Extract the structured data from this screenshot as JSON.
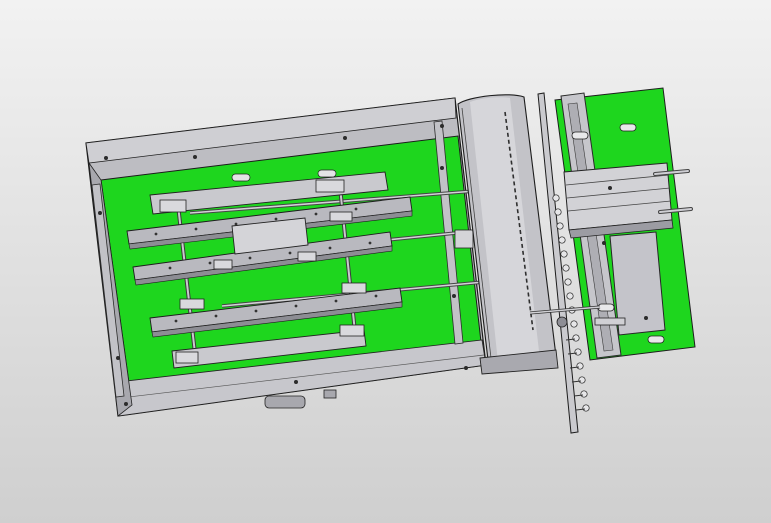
{
  "viewport": {
    "background_top": "#f2f2f2",
    "background_bottom": "#cfcfcf"
  },
  "model": {
    "plate_color": "#1ed61e",
    "metal_color": "#b8b8be",
    "metal_dark": "#8a8a90",
    "edge_color": "#2c2c2c"
  }
}
